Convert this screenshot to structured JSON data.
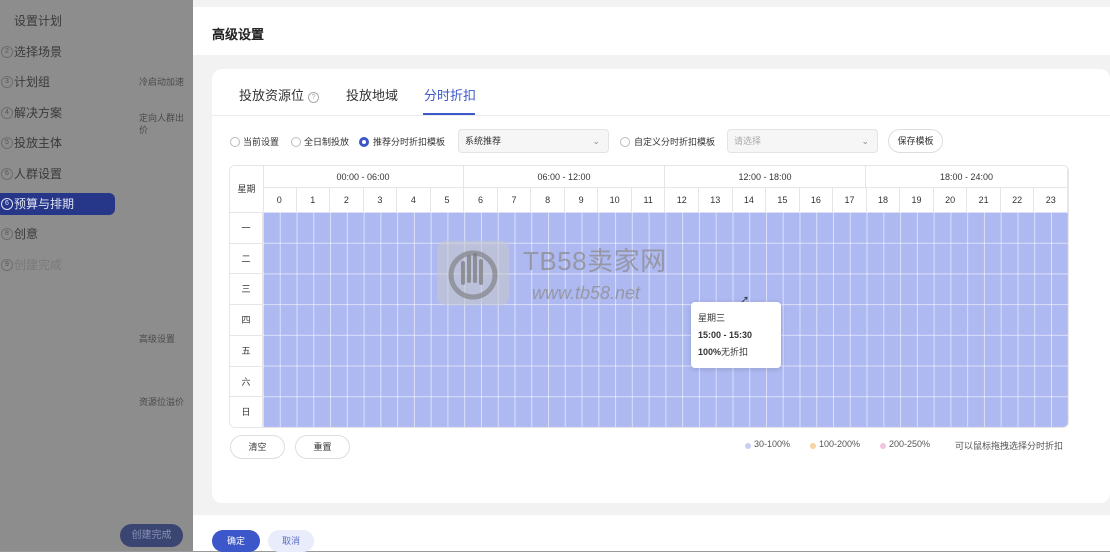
{
  "sidebar": {
    "steps": [
      {
        "num": "",
        "label": "设置计划"
      },
      {
        "num": "2",
        "label": "选择场景"
      },
      {
        "num": "3",
        "label": "计划组"
      },
      {
        "num": "4",
        "label": "解决方案"
      },
      {
        "num": "5",
        "label": "投放主体"
      },
      {
        "num": "6",
        "label": "人群设置"
      },
      {
        "num": "6",
        "label": "预算与排期"
      },
      {
        "num": "8",
        "label": "创意"
      },
      {
        "num": "9",
        "label": "创建完成"
      }
    ],
    "labels": [
      "冷启动加速",
      "定向人群出价",
      "高级设置",
      "资源位溢价"
    ],
    "create_button": "创建完成"
  },
  "header": {
    "title": "高级设置"
  },
  "tabs": [
    "投放资源位",
    "投放地域",
    "分时折扣"
  ],
  "options": {
    "current": "当前设置",
    "all_day": "全日制投放",
    "recommended": "推荐分时折扣模板",
    "recommended_select": "系统推荐",
    "custom": "自定义分时折扣模板",
    "custom_placeholder": "请选择",
    "save_template": "保存模板"
  },
  "grid": {
    "weekday_header": "星期",
    "ranges": [
      "00:00 - 06:00",
      "06:00 - 12:00",
      "12:00 - 18:00",
      "18:00 - 24:00"
    ],
    "hours": [
      "0",
      "1",
      "2",
      "3",
      "4",
      "5",
      "6",
      "7",
      "8",
      "9",
      "10",
      "11",
      "12",
      "13",
      "14",
      "15",
      "16",
      "17",
      "18",
      "19",
      "20",
      "21",
      "22",
      "23"
    ],
    "days": [
      "一",
      "二",
      "三",
      "四",
      "五",
      "六",
      "日"
    ],
    "fill_color": "#aeb9f2"
  },
  "tooltip": {
    "day": "星期三",
    "time": "15:00 - 15:30",
    "discount_bold": "100%",
    "discount_text": "无折扣"
  },
  "watermark": {
    "brand": "TB58卖家网",
    "url": "www.tb58.net"
  },
  "actions": {
    "clear": "清空",
    "reset": "重置"
  },
  "legend": [
    {
      "label": "30-100%",
      "color": "#c9cef5"
    },
    {
      "label": "100-200%",
      "color": "#f7d3a6"
    },
    {
      "label": "200-250%",
      "color": "#f2c4dc"
    }
  ],
  "hint": "可以鼠标拖拽选择分时折扣",
  "footer": {
    "ok": "确定",
    "cancel": "取消"
  },
  "colors": {
    "accent": "#3b57c9",
    "sidebar_active": "#26378a"
  }
}
